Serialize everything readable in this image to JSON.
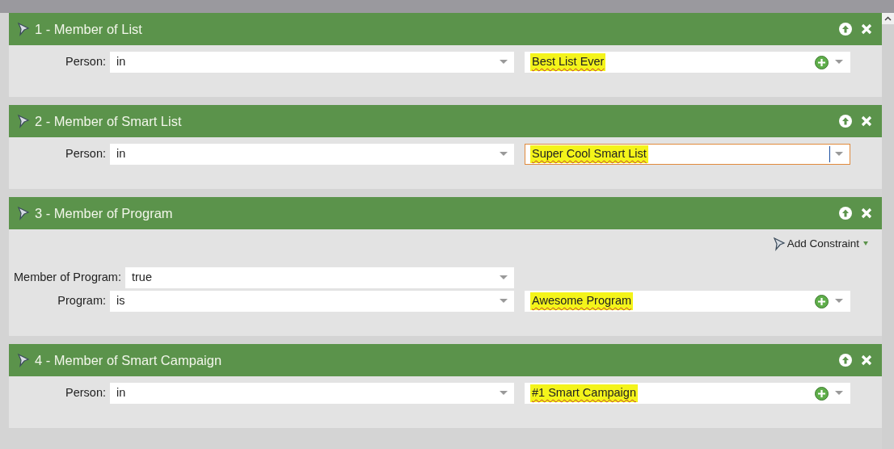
{
  "filters": [
    {
      "title": "1 - Member of List",
      "rows": [
        {
          "label": "Person:",
          "operator": "in",
          "value": {
            "text": "Best List Ever",
            "focused": false
          }
        }
      ]
    },
    {
      "title": "2 - Member of Smart List",
      "rows": [
        {
          "label": "Person:",
          "operator": "in",
          "value": {
            "text": "Super Cool Smart List",
            "focused": true
          }
        }
      ]
    },
    {
      "title": "3 - Member of Program",
      "add_constraint": "Add Constraint",
      "rows": [
        {
          "label": "Member of Program:",
          "operator": "true"
        },
        {
          "label": "Program:",
          "operator": "is",
          "value": {
            "text": "Awesome Program",
            "focused": false
          }
        }
      ]
    },
    {
      "title": "4 - Member of Smart Campaign",
      "rows": [
        {
          "label": "Person:",
          "operator": "in",
          "value": {
            "text": "#1 Smart Campaign",
            "focused": false
          }
        }
      ]
    }
  ]
}
